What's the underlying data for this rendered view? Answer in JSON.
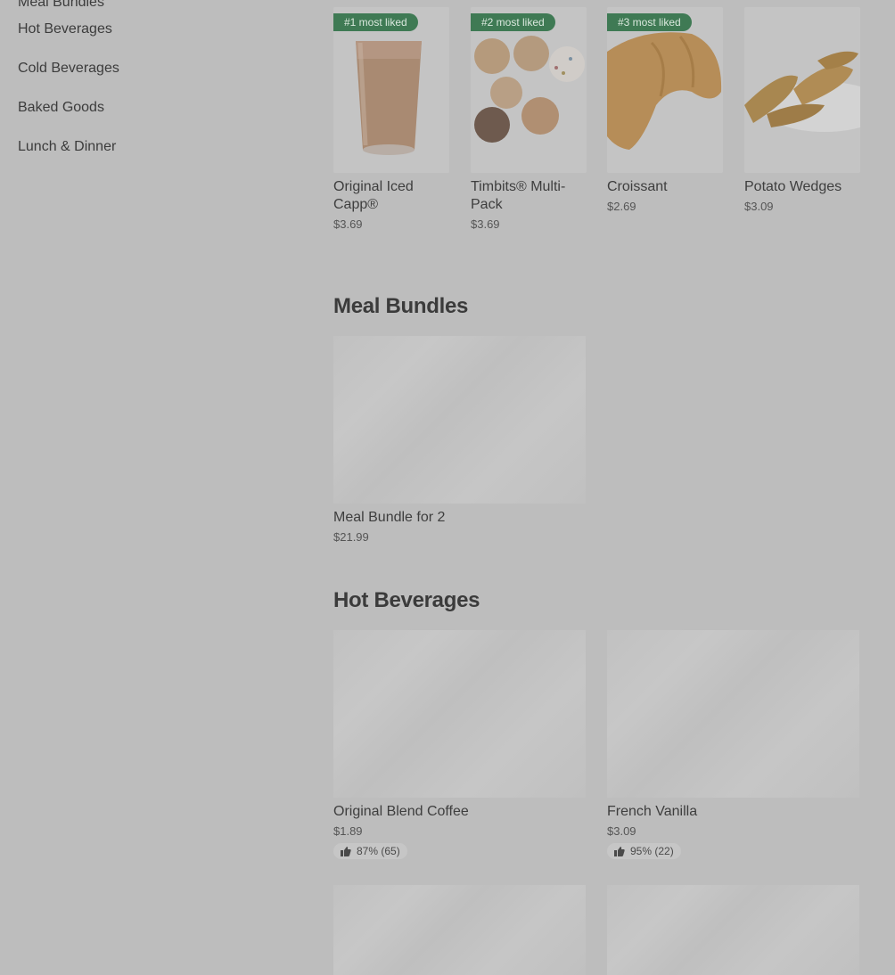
{
  "sidebar": {
    "items": [
      {
        "label": "Meal Bundles"
      },
      {
        "label": "Hot Beverages"
      },
      {
        "label": "Cold Beverages"
      },
      {
        "label": "Baked Goods"
      },
      {
        "label": "Lunch & Dinner"
      }
    ]
  },
  "popular": [
    {
      "badge": "#1 most liked",
      "name": "Original Iced Capp®",
      "price": "$3.69",
      "image": "iced-capp-image"
    },
    {
      "badge": "#2 most liked",
      "name": "Timbits® Multi-Pack",
      "price": "$3.69",
      "image": "timbits-image"
    },
    {
      "badge": "#3 most liked",
      "name": "Croissant",
      "price": "$2.69",
      "image": "croissant-image"
    },
    {
      "badge": "",
      "name": "Potato Wedges",
      "price": "$3.09",
      "image": "potato-wedges-image"
    }
  ],
  "meal_bundles": {
    "title": "Meal Bundles",
    "items": [
      {
        "name": "Meal Bundle for 2",
        "price": "$21.99"
      }
    ]
  },
  "hot_beverages": {
    "title": "Hot Beverages",
    "items": [
      {
        "name": "Original Blend Coffee",
        "price": "$1.89",
        "rating": "87% (65)"
      },
      {
        "name": "French Vanilla",
        "price": "$3.09",
        "rating": "95% (22)"
      }
    ]
  },
  "colors": {
    "badge_bg": "#3f7a54",
    "page_bg": "#bdbdbd"
  }
}
